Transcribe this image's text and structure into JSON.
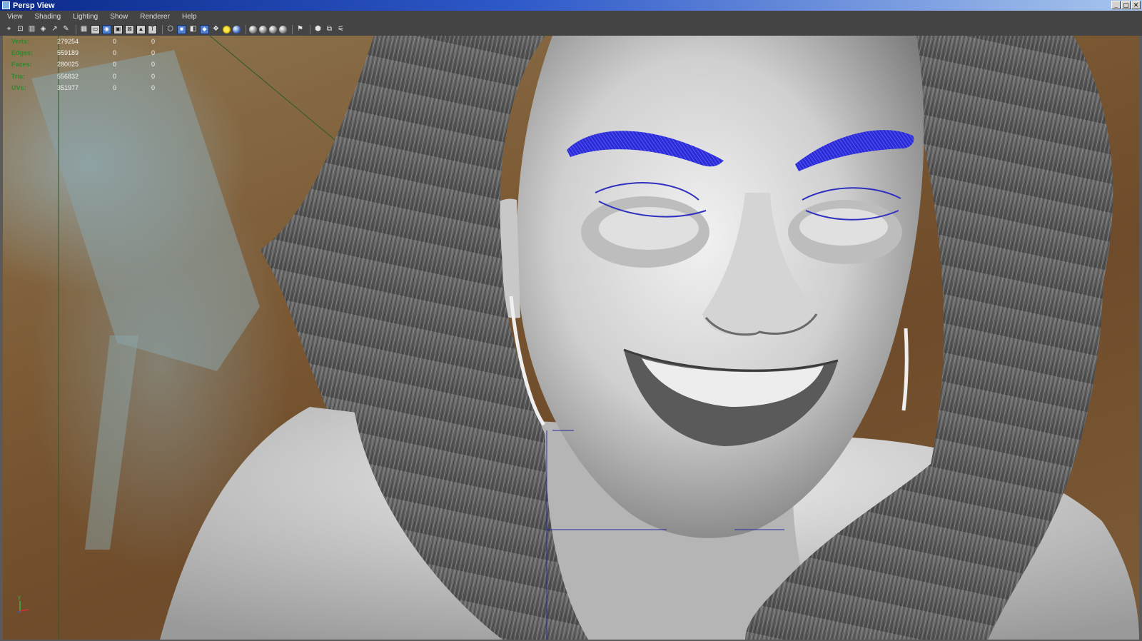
{
  "window": {
    "title": "Persp View",
    "controls": [
      "_",
      "▢",
      "✕"
    ]
  },
  "menu": {
    "items": [
      "View",
      "Shading",
      "Lighting",
      "Show",
      "Renderer",
      "Help"
    ]
  },
  "toolbar": {
    "groups": [
      [
        "select-camera-icon",
        "lock-camera-icon",
        "bookmark-icon",
        "image-plane-icon",
        "2d-pan-icon",
        "grease-pencil-icon"
      ],
      [
        "grid-icon",
        "film-gate-icon",
        "resolution-gate-icon",
        "gate-mask-icon",
        "field-chart-icon",
        "safe-action-icon",
        "safe-title-icon"
      ],
      [
        "wireframe-icon",
        "smooth-shade-icon",
        "default-material-icon",
        "textured-icon",
        "use-all-lights-icon",
        "shadows-icon"
      ],
      [
        "isolate-select-icon",
        "xray-icon",
        "xray-joints-icon",
        "xray-components-icon"
      ],
      [
        "camera-attributes-icon"
      ],
      [
        "viewport-20-icon",
        "viewport-layout-icon",
        "symmetry-icon"
      ]
    ]
  },
  "hud": {
    "rows": [
      {
        "label": "Verts:",
        "v1": "279254",
        "v2": "0",
        "v3": "0"
      },
      {
        "label": "Edges:",
        "v1": "559189",
        "v2": "0",
        "v3": "0"
      },
      {
        "label": "Faces:",
        "v1": "280025",
        "v2": "0",
        "v3": "0"
      },
      {
        "label": "Tris:",
        "v1": "556832",
        "v2": "0",
        "v3": "0"
      },
      {
        "label": "UVs:",
        "v1": "351977",
        "v2": "0",
        "v3": "0"
      }
    ]
  },
  "axis": {
    "label": "y"
  },
  "colors": {
    "hud_label": "#2c8a2c",
    "eyebrow_curves": "#2424d8",
    "title_bar_start": "#0b2a8a",
    "title_bar_end": "#a9c6ee"
  }
}
